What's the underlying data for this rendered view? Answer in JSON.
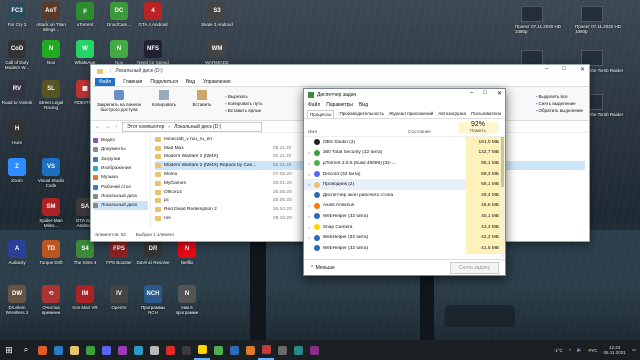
{
  "desktop_icons": [
    {
      "label": "Far Cry 3",
      "color": "#2b4a5a",
      "glyph": "FC3"
    },
    {
      "label": "Attack on Titan Wings...",
      "color": "#5a3a2a",
      "glyph": "AoT"
    },
    {
      "label": "uTorrent",
      "color": "#2e8b2e",
      "glyph": "µ"
    },
    {
      "label": "DroidCam...",
      "color": "#3c9a3c",
      "glyph": "DC"
    },
    {
      "label": "GTA 4 Android",
      "color": "#b22",
      "glyph": "4"
    },
    {
      "label": "Skate 3 Android",
      "color": "#444",
      "glyph": "S3"
    },
    {
      "label": "Call of Duty Modern W...",
      "color": "#333",
      "glyph": "CoD"
    },
    {
      "label": "Nox",
      "color": "#2a2",
      "glyph": "N"
    },
    {
      "label": "WhatsApp",
      "color": "#25d366",
      "glyph": "W"
    },
    {
      "label": "Nox",
      "color": "#4a4",
      "glyph": "N"
    },
    {
      "label": "Need for Speed",
      "color": "#223",
      "glyph": "NFS"
    },
    {
      "label": "WARMODE",
      "color": "#444",
      "glyph": "WM"
    },
    {
      "label": "Road to Vostok",
      "color": "#334",
      "glyph": "RV"
    },
    {
      "label": "Street Legal Racing",
      "color": "#552",
      "glyph": "SL"
    },
    {
      "label": "ПОКУПКИ",
      "color": "#b33",
      "glyph": "▦"
    },
    {
      "label": "Hunt",
      "color": "#333",
      "glyph": "H"
    },
    {
      "label": "Zoom",
      "color": "#2d8cff",
      "glyph": "Z"
    },
    {
      "label": "Visual Studio Code",
      "color": "#1c6fc1",
      "glyph": "VS"
    },
    {
      "label": "GTA San Andreas",
      "color": "#3a3a3a",
      "glyph": "SA"
    },
    {
      "label": "Spider-Man Miles...",
      "color": "#a22",
      "glyph": "SM"
    },
    {
      "label": "Audacity",
      "color": "#2a3f9a",
      "glyph": "A"
    },
    {
      "label": "Torque Drift",
      "color": "#b52",
      "glyph": "TD"
    },
    {
      "label": "The Sims 4",
      "color": "#3a8a3a",
      "glyph": "S4"
    },
    {
      "label": "FPS Booster",
      "color": "#822",
      "glyph": "FPS"
    },
    {
      "label": "DaVinci Resolve",
      "color": "#333",
      "glyph": "DR"
    },
    {
      "label": "Netflix",
      "color": "#e50914",
      "glyph": "N"
    },
    {
      "label": "Drunken Wrestlers 2",
      "color": "#654",
      "glyph": "DW"
    },
    {
      "label": "Очистка времени",
      "color": "#a33",
      "glyph": "⟲"
    },
    {
      "label": "Iron Man VR",
      "color": "#a22",
      "glyph": "IM"
    },
    {
      "label": "OpenIV",
      "color": "#444",
      "glyph": "IV"
    },
    {
      "label": "Программы NCH",
      "color": "#2a5a8a",
      "glyph": "NCH"
    },
    {
      "label": "Ник в программе",
      "color": "#555",
      "glyph": "N"
    }
  ],
  "explorer": {
    "title": "Локальный диск (D:)",
    "tabs": [
      "Файл",
      "Главная",
      "Поделиться",
      "Вид",
      "Управление"
    ],
    "ribbon": {
      "pin": "Закрепить на панели быстрого доступа",
      "copy": "Копировать",
      "paste": "Вставить",
      "cut": "Вырезать",
      "copy_path": "Копировать путь",
      "paste_shortcut": "Вставить ярлык",
      "move": "Переместить в",
      "select_all": "Выделить все",
      "deselect": "Снять выделение",
      "invert": "Обратить выделение"
    },
    "address": [
      "Этот компьютер",
      "Локальный диск (D:)"
    ],
    "tree": [
      {
        "label": "Видео",
        "color": "#7a5ab8"
      },
      {
        "label": "Документы",
        "color": "#8a8a8a"
      },
      {
        "label": "Загрузки",
        "color": "#3a7ac8"
      },
      {
        "label": "Изображения",
        "color": "#3aa0c8"
      },
      {
        "label": "Музыка",
        "color": "#e07a2a"
      },
      {
        "label": "Рабочий стол",
        "color": "#3a7ac8"
      },
      {
        "label": "Локальный диск",
        "color": "#888"
      },
      {
        "label": "Локальный диск",
        "color": "#888"
      }
    ],
    "files": [
      {
        "name": "minecraft_v ruu_ru_en",
        "date": ""
      },
      {
        "name": "Mad Max",
        "date": "06.11.20"
      },
      {
        "name": "Modern Warfare 2 [IW4X]",
        "date": "02.11.20"
      },
      {
        "name": "Modern Warfare 2 [IW4X] Repack by Can...",
        "date": "02.11.20"
      },
      {
        "name": "Momo",
        "date": "07.05.20"
      },
      {
        "name": "MyGames",
        "date": "20.01.20"
      },
      {
        "name": "Office14",
        "date": "25.05.20"
      },
      {
        "name": "pc",
        "date": "25.05.20"
      },
      {
        "name": "Red Dead Redemption 2",
        "date": "26.10.20"
      },
      {
        "name": "ros",
        "date": "29.10.20"
      }
    ],
    "status_count": "Элементов: 62",
    "status_selected": "Выбран 1 элемент"
  },
  "task_manager": {
    "title": "Диспетчер задач",
    "menu": [
      "Файл",
      "Параметры",
      "Вид"
    ],
    "tabs": [
      "Процессы",
      "Производительность",
      "Журнал приложений",
      "Автозагрузка",
      "Пользователи"
    ],
    "col_name": "Имя",
    "col_status": "Состояние",
    "mem_pct": "92%",
    "col_mem": "Память",
    "processes": [
      {
        "arrow": "",
        "name": "OBS Studio (3)",
        "mem": "181,0 МБ",
        "color": "#222"
      },
      {
        "arrow": ">",
        "name": "360 Total Security (32 бита)",
        "mem": "132,7 МБ",
        "color": "#3aa03a"
      },
      {
        "arrow": ">",
        "name": "µTorrent 3.5.5  (build 46096) [32-...",
        "mem": "96,1 МБ",
        "color": "#4caf50"
      },
      {
        "arrow": ">",
        "name": "Discord (32 бита)",
        "mem": "89,3 МБ",
        "color": "#5865f2"
      },
      {
        "arrow": ">",
        "name": "Проводник (2)",
        "mem": "56,1 МБ",
        "color": "#e9c46a"
      },
      {
        "arrow": "",
        "name": "Диспетчер окон рабочего стола",
        "mem": "49,4 МБ",
        "color": "#2a6ab8"
      },
      {
        "arrow": ">",
        "name": "Avast Antivirus",
        "mem": "46,5 МБ",
        "color": "#ff7800"
      },
      {
        "arrow": ">",
        "name": "WebHelper (32 бита)",
        "mem": "45,1 МБ",
        "color": "#2a6ab8"
      },
      {
        "arrow": ">",
        "name": "Snap Camera",
        "mem": "43,3 МБ",
        "color": "#ffd600"
      },
      {
        "arrow": ">",
        "name": "WebHelper (32 бита)",
        "mem": "42,2 МБ",
        "color": "#2a6ab8"
      },
      {
        "arrow": "",
        "name": "WebHelper (32 бита)",
        "mem": "41,5 МБ",
        "color": "#2a6ab8"
      }
    ],
    "less": "Меньше",
    "end_task": "Снять задачу"
  },
  "notifications": [
    {
      "text": "Проект 07.11.2020 HD 1080p"
    },
    {
      "text": "Проект 07.11.2020 HD 1080p"
    },
    {
      "text": "Проект 26.10.20 HD 1080p"
    },
    {
      "text": "Rise of the Tomb Raider"
    },
    {
      "text": "Проект 06.10.2020 HD 1080p"
    },
    {
      "text": "Rise of the Tomb Raider"
    }
  ],
  "taskbar": {
    "time": "12:43",
    "date": "06.11.2021",
    "lang": "РУС",
    "temp": "-1°C",
    "icons": [
      "#e05a2a",
      "#2a7ac8",
      "#e9c46a",
      "#3aa03a",
      "#5865f2",
      "#9a3ab8",
      "#2a9ac8",
      "#b8b8b8",
      "#e02a2a",
      "#3a3a3a",
      "#ffd600",
      "#4caf50",
      "#2a6ab8",
      "#e07a2a",
      "#c83a3a",
      "#6a6a6a",
      "#2a8a8a",
      "#8a2a8a"
    ]
  }
}
